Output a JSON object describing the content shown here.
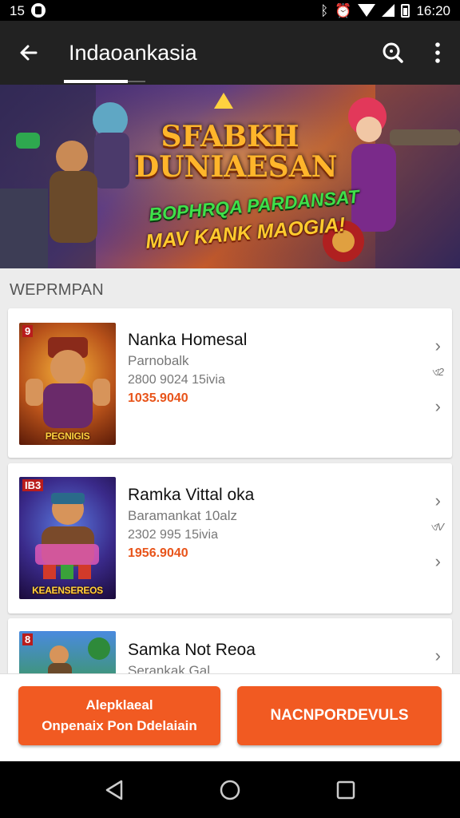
{
  "status_bar": {
    "left_text": "15",
    "time": "16:20",
    "icons": [
      "notification-icon",
      "bluetooth-icon",
      "alarm-icon",
      "wifi-icon",
      "signal-icon",
      "battery-icon"
    ]
  },
  "app_bar": {
    "title": "Indaoankasia",
    "back_icon": "arrow-left-icon",
    "search_icon": "search-icon",
    "menu_icon": "more-vert-icon"
  },
  "banner": {
    "title_line1": "SFABKH",
    "title_line2": "DUNIAESAN",
    "subtitle_line1": "BOPHRQA PARDANSAT",
    "subtitle_line2": "MAV KANK MAOGIA!"
  },
  "section": {
    "heading": "WEPRMPAN"
  },
  "items": [
    {
      "badge": "9",
      "caption": "PEGNIGIS",
      "title": "Nanka Homesal",
      "subtitle": "Parnobalk",
      "meta": "2800 9024 15ivia",
      "price": "1035.9040",
      "side_value": "ଏ2"
    },
    {
      "badge": "IB3",
      "caption": "KEAENSEREOS",
      "title": "Ramka Vittal oka",
      "subtitle": "Baramankat 10alz",
      "meta": "2302 995 15ivia",
      "price": "1956.9040",
      "side_value": "ଏV"
    },
    {
      "badge": "8",
      "caption": "",
      "title": "Samka Not Reoa",
      "subtitle": "Serankak Gal",
      "meta": "",
      "price": "",
      "side_value": ""
    }
  ],
  "actions": {
    "left_line1": "Alepklaeal",
    "left_line2": "Onpenaix Pon Ddelaiain",
    "right_label": "NACNPORDEVULS"
  },
  "colors": {
    "accent": "#f15a22",
    "appbar": "#222222",
    "price": "#e8541a"
  }
}
